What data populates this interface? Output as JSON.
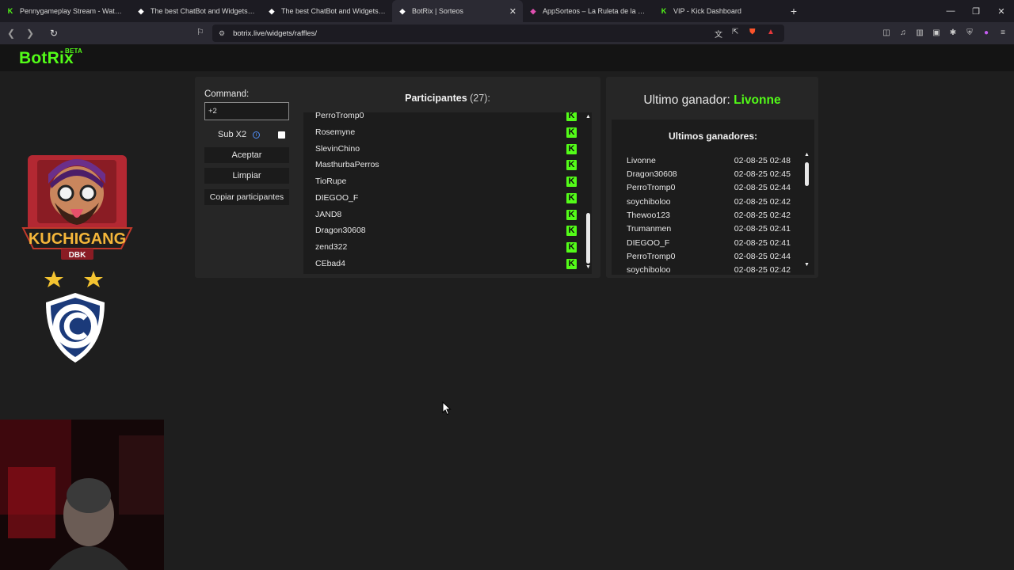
{
  "browser": {
    "tabs": [
      {
        "title": "Pennygameplay Stream - Watch Live",
        "icon": "kick-icon",
        "active": false
      },
      {
        "title": "The best ChatBot and Widgets fo",
        "icon": "botrix-icon",
        "active": false
      },
      {
        "title": "The best ChatBot and Widgets for Ki",
        "icon": "botrix-icon",
        "active": false
      },
      {
        "title": "BotRix | Sorteos",
        "icon": "botrix-icon",
        "active": true
      },
      {
        "title": "AppSorteos – La Ruleta de la Suerte",
        "icon": "appsorteos-icon",
        "active": false
      },
      {
        "title": "VIP - Kick Dashboard",
        "icon": "kick-icon",
        "active": false
      }
    ],
    "url": "botrix.live/widgets/raffles/"
  },
  "site": {
    "logo": "BotRix",
    "logo_badge": "BETA"
  },
  "overlay": {
    "streamer_logo_text": "KUCHIGANG",
    "streamer_logo_sub": "DBK"
  },
  "raffle": {
    "command_label": "Command:",
    "command_value": "+2",
    "sub_label": "Sub X2",
    "accept_label": "Aceptar",
    "clear_label": "Limpiar",
    "copy_label": "Copiar participantes",
    "participants_title": "Participantes",
    "participants_count": "(27):",
    "participants": [
      "PerroTromp0",
      "Rosemyne",
      "SlevinChino",
      "MasthurbaPerros",
      "TioRupe",
      "DIEGOO_F",
      "JAND8",
      "Dragon30608",
      "zend322",
      "CEbad4"
    ]
  },
  "winners": {
    "last_winner_label": "Ultimo ganador:",
    "last_winner_name": "Livonne",
    "list_title": "Ultimos ganadores:",
    "rows": [
      {
        "name": "Livonne",
        "time": "02-08-25 02:48"
      },
      {
        "name": "Dragon30608",
        "time": "02-08-25 02:45"
      },
      {
        "name": "PerroTromp0",
        "time": "02-08-25 02:44"
      },
      {
        "name": "soychiboloo",
        "time": "02-08-25 02:42"
      },
      {
        "name": "Thewoo123",
        "time": "02-08-25 02:42"
      },
      {
        "name": "Trumanmen",
        "time": "02-08-25 02:41"
      },
      {
        "name": "DIEGOO_F",
        "time": "02-08-25 02:41"
      },
      {
        "name": "PerroTromp0",
        "time": "02-08-25 02:44"
      },
      {
        "name": "soychiboloo",
        "time": "02-08-25 02:42"
      }
    ]
  },
  "colors": {
    "kick_green": "#53fc18",
    "panel": "#262626",
    "inner": "#1c1c1c"
  }
}
